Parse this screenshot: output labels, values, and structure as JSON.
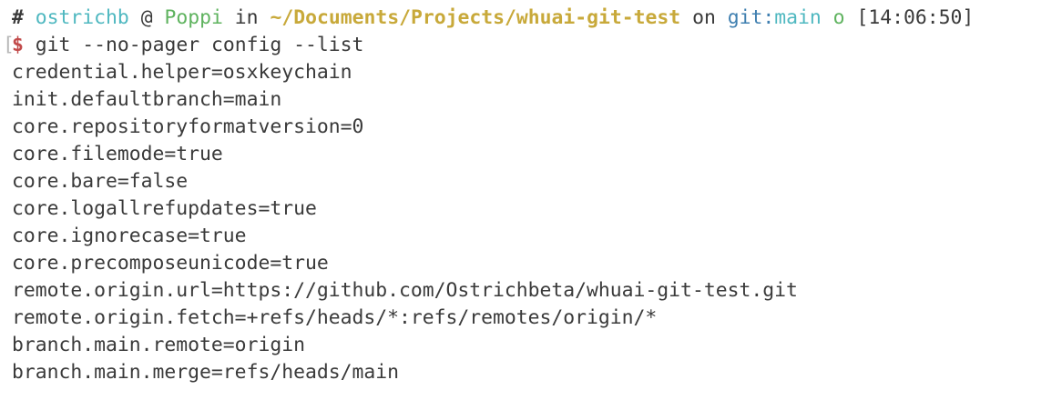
{
  "prompt": {
    "hash": "#",
    "user": "ostrichb",
    "at": "@",
    "host": "Poppi",
    "in": "in",
    "path": "~/Documents/Projects/whuai-git-test",
    "on": "on",
    "git_label": "git:",
    "branch": "main",
    "status": "o",
    "time": "[14:06:50]"
  },
  "command": {
    "bracket": "[",
    "symbol": "$",
    "text": "git --no-pager config --list"
  },
  "output": [
    "credential.helper=osxkeychain",
    "init.defaultbranch=main",
    "core.repositoryformatversion=0",
    "core.filemode=true",
    "core.bare=false",
    "core.logallrefupdates=true",
    "core.ignorecase=true",
    "core.precomposeunicode=true",
    "remote.origin.url=https://github.com/Ostrichbeta/whuai-git-test.git",
    "remote.origin.fetch=+refs/heads/*:refs/remotes/origin/*",
    "branch.main.remote=origin",
    "branch.main.merge=refs/heads/main"
  ],
  "colors": {
    "background": "#ffffff",
    "text": "#3a3a3a",
    "user": "#4fb8c0",
    "host": "#5fb35f",
    "path": "#c8a93a",
    "git_label": "#3f7fb0",
    "dollar": "#c24b4b"
  }
}
